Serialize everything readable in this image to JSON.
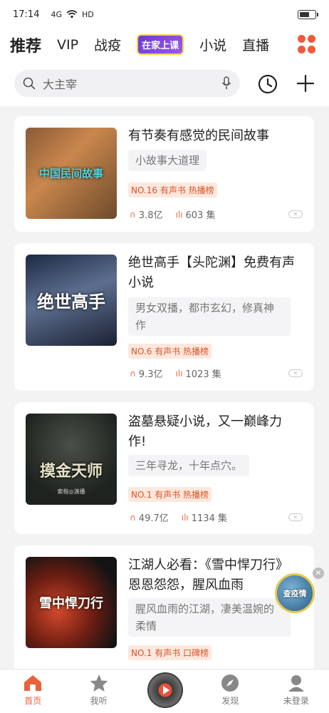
{
  "status": {
    "time": "17:14",
    "network": "4G",
    "hd": "HD",
    "battery": 0.7
  },
  "tabs": [
    "推荐",
    "VIP",
    "战疫",
    "在家上课",
    "小说",
    "直播"
  ],
  "search": {
    "placeholder": "大主宰"
  },
  "cards": [
    {
      "title": "有节奏有感觉的民间故事",
      "desc": "小故事大道理",
      "rank": "NO.16 有声书 热播榜",
      "plays": "3.8亿",
      "episodes": "603 集",
      "cover_text": "中国民间故事"
    },
    {
      "title": "绝世高手【头陀渊】免费有声小说",
      "desc": "男女双播，都市玄幻，修真神作",
      "rank": "NO.6 有声书 热播榜",
      "plays": "9.3亿",
      "episodes": "1023 集",
      "cover_text": "绝世高手"
    },
    {
      "title": "盗墓悬疑小说，又一巅峰力作!",
      "desc": "三年寻龙，十年点穴。",
      "rank": "NO.1 有声书 热播榜",
      "plays": "49.7亿",
      "episodes": "1134 集",
      "cover_text": "摸金天师",
      "cover_sub": "索楷◎演播"
    },
    {
      "title": "江湖人必看：《雪中悍刀行》恩恩怨怨，腥风血雨",
      "desc": "腥风血雨的江湖，凄美温婉的柔情",
      "rank": "NO.1 有声书 口碑榜",
      "cover_text": "雪中悍刀行"
    }
  ],
  "float_badge": "查疫情",
  "bottom_nav": {
    "home": "首页",
    "mine": "我听",
    "discover": "发现",
    "login": "未登录"
  },
  "colors": {
    "accent": "#e8613b",
    "rank_bg": "#fde8dd"
  },
  "icons": {
    "search": "search-icon",
    "mic": "mic-icon",
    "history": "clock-icon",
    "add": "plus-icon",
    "grid": "app-grid-icon",
    "headphones": "headphones-icon",
    "audio": "audio-wave-icon",
    "dismiss": "dismiss-icon"
  }
}
